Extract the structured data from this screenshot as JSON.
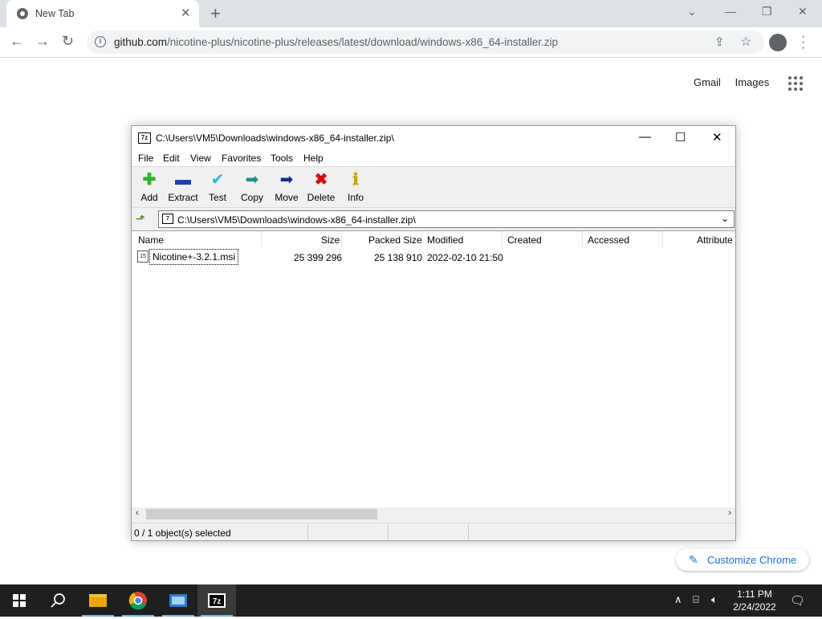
{
  "browser": {
    "tab_title": "New Tab",
    "tab_close": "✕",
    "new_tab": "+",
    "url_domain": "github.com",
    "url_path": "/nicotine-plus/nicotine-plus/releases/latest/download/windows-x86_64-installer.zip",
    "ntp_links": [
      "Gmail",
      "Images"
    ],
    "customize_label": "Customize Chrome"
  },
  "app": {
    "title": "C:\\Users\\VM5\\Downloads\\windows-x86_64-installer.zip\\",
    "menu": [
      "File",
      "Edit",
      "View",
      "Favorites",
      "Tools",
      "Help"
    ],
    "toolbar": [
      {
        "label": "Add",
        "icon": "add-icon",
        "color": "#2db52d"
      },
      {
        "label": "Extract",
        "icon": "extract-icon",
        "color": "#1a3fbf"
      },
      {
        "label": "Test",
        "icon": "test-icon",
        "color": "#27b7c9"
      },
      {
        "label": "Copy",
        "icon": "copy-icon",
        "color": "#1f8f8f"
      },
      {
        "label": "Move",
        "icon": "move-icon",
        "color": "#1a2a8f"
      },
      {
        "label": "Delete",
        "icon": "delete-icon",
        "color": "#d01010"
      },
      {
        "label": "Info",
        "icon": "info-icon",
        "color": "#c8a800"
      }
    ],
    "address": "C:\\Users\\VM5\\Downloads\\windows-x86_64-installer.zip\\",
    "columns": [
      "Name",
      "Size",
      "Packed Size",
      "Modified",
      "Created",
      "Accessed",
      "Attribute"
    ],
    "rows": [
      {
        "name": "Nicotine+-3.2.1.msi",
        "size": "25 399 296",
        "packed": "25 138 910",
        "modified": "2022-02-10 21:50",
        "created": "",
        "accessed": "",
        "attributes": ""
      }
    ],
    "status": "0 / 1 object(s) selected"
  },
  "taskbar": {
    "time": "1:11 PM",
    "date": "2/24/2022",
    "pinned": [
      "start-icon",
      "search-icon",
      "file-explorer-icon",
      "chrome-icon",
      "control-panel-icon",
      "7zip-icon"
    ]
  }
}
